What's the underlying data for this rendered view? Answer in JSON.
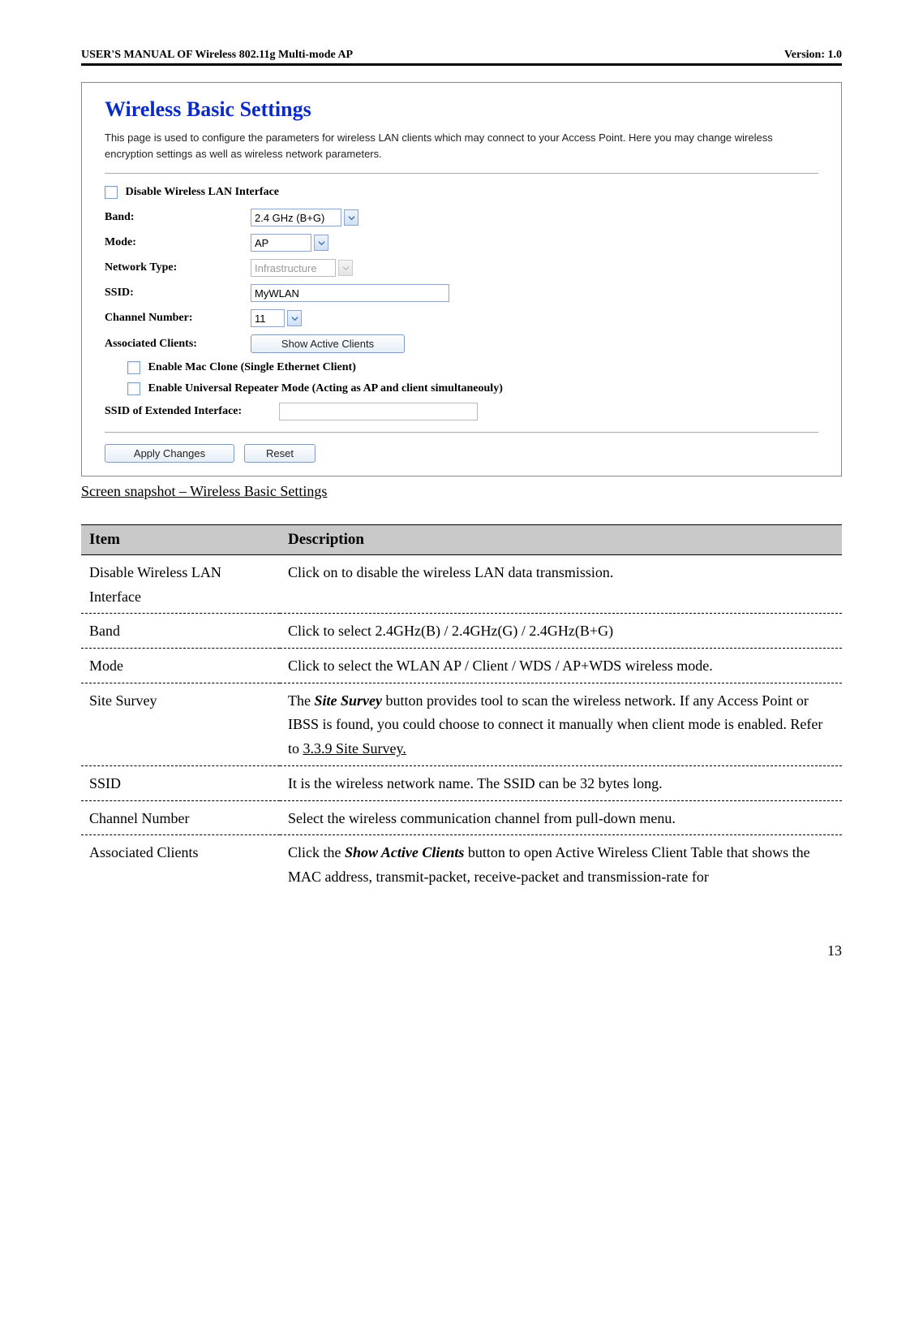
{
  "header": {
    "left": "USER'S MANUAL OF Wireless 802.11g Multi-mode AP",
    "right": "Version: 1.0"
  },
  "panel": {
    "title": "Wireless Basic Settings",
    "intro": "This page is used to configure the parameters for wireless LAN clients which may connect to your Access Point. Here you may change wireless encryption settings as well as wireless network parameters.",
    "disable_label": "Disable Wireless LAN Interface",
    "band_label": "Band:",
    "band_value": "2.4 GHz (B+G)",
    "mode_label": "Mode:",
    "mode_value": "AP",
    "nettype_label": "Network Type:",
    "nettype_value": "Infrastructure",
    "ssid_label": "SSID:",
    "ssid_value": "MyWLAN",
    "channel_label": "Channel Number:",
    "channel_value": "11",
    "assoc_label": "Associated Clients:",
    "show_active": "Show Active Clients",
    "mac_clone_label": "Enable Mac Clone (Single Ethernet Client)",
    "univ_repeater_label": "Enable Universal Repeater Mode (Acting as AP and client simultaneouly)",
    "ext_ssid_label": "SSID of Extended Interface:",
    "ext_ssid_value": "",
    "apply": "Apply Changes",
    "reset": "Reset"
  },
  "caption": "Screen snapshot – Wireless Basic Settings",
  "table": {
    "head_item": "Item",
    "head_desc": "Description",
    "rows": [
      {
        "item": "Disable Wireless LAN Interface",
        "desc": "Click on to disable the wireless LAN data transmission."
      },
      {
        "item": "Band",
        "desc": "Click to select 2.4GHz(B) / 2.4GHz(G) / 2.4GHz(B+G)"
      },
      {
        "item": "Mode",
        "desc": "Click to select the WLAN AP / Client / WDS / AP+WDS wireless mode."
      },
      {
        "item": "Site Survey",
        "desc_pre": "The ",
        "desc_em": "Site Survey",
        "desc_mid": " button provides tool to scan the wireless network. If any Access Point or IBSS is found, you could choose to connect it manually when client mode is enabled. Refer to ",
        "desc_link": "3.3.9 Site Survey.",
        "desc_post": ""
      },
      {
        "item": "SSID",
        "desc": "It is the wireless network name. The SSID can be 32 bytes long."
      },
      {
        "item": "Channel Number",
        "desc": "Select the wireless communication channel from pull-down menu."
      },
      {
        "item": "Associated Clients",
        "desc_pre": "Click the ",
        "desc_em": "Show Active Clients",
        "desc_post": " button to open Active Wireless Client Table that shows the MAC address, transmit-packet, receive-packet and transmission-rate for"
      }
    ]
  },
  "pageno": "13"
}
